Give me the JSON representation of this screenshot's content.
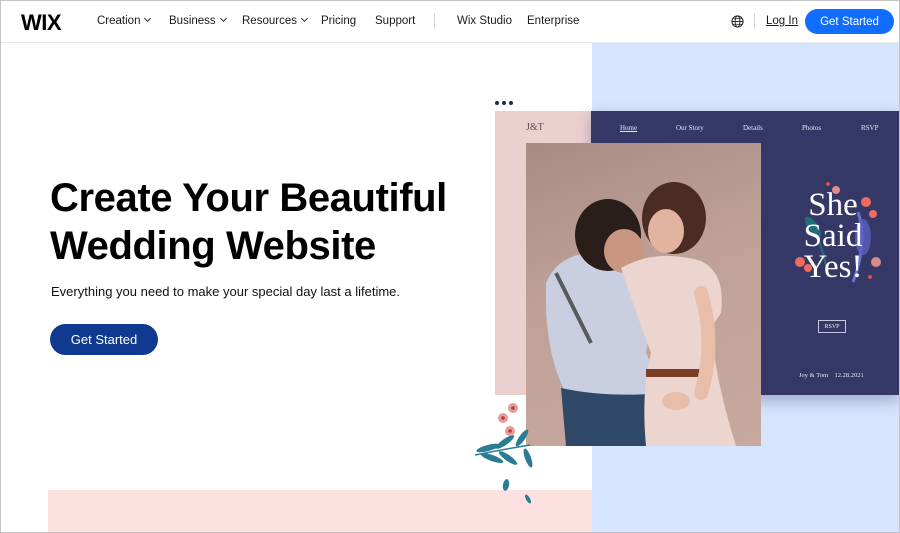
{
  "header": {
    "logo": "WIX",
    "nav": [
      {
        "label": "Creation",
        "has_dropdown": true
      },
      {
        "label": "Business",
        "has_dropdown": true
      },
      {
        "label": "Resources",
        "has_dropdown": true
      },
      {
        "label": "Pricing",
        "has_dropdown": false
      },
      {
        "label": "Support",
        "has_dropdown": false
      },
      {
        "label": "Wix Studio",
        "has_dropdown": false
      },
      {
        "label": "Enterprise",
        "has_dropdown": false
      }
    ],
    "language_icon": "globe-icon",
    "login_label": "Log In",
    "cta_label": "Get Started",
    "cta_color": "#116dff"
  },
  "hero": {
    "title_line1": "Create Your Beautiful",
    "title_line2": "Wedding Website",
    "subtitle": "Everything you need to make your special day last a lifetime.",
    "cta_label": "Get Started",
    "cta_color": "#0f3a8f"
  },
  "mockup": {
    "logo": "J&T",
    "nav": [
      "Home",
      "Our Story",
      "Details",
      "Photos",
      "RSVP"
    ],
    "active_nav": "Home",
    "headline_line1": "She",
    "headline_line2": "Said",
    "headline_line3": "Yes!",
    "rsvp_label": "RSVP",
    "couple": "Joy & Tom",
    "date": "12.28.2021",
    "more_icon": "more-dots-icon",
    "photo_description": "couple-embracing-photo",
    "colors": {
      "navy": "#353866",
      "pink": "#ecd0d0",
      "blue_bg": "#d5e5fd",
      "pink_bg": "#fde0e0"
    }
  }
}
